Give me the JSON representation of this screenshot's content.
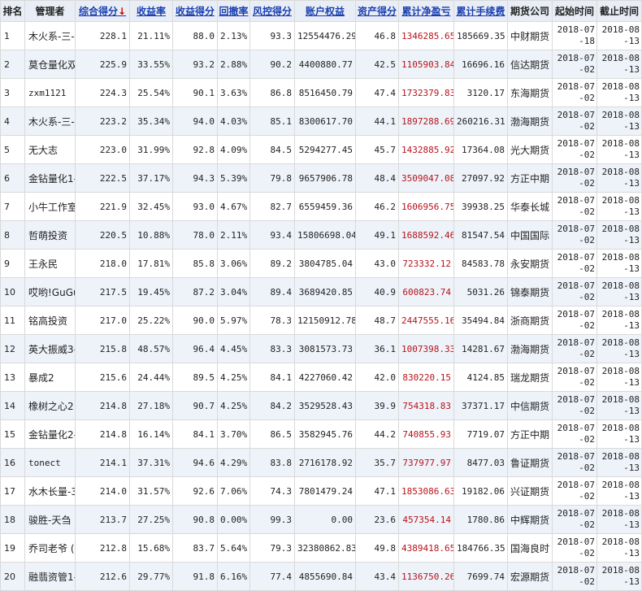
{
  "colors": {
    "header_bg": "#e9eef6",
    "link": "#1a3fb0",
    "profit": "#b8121a",
    "stripe": "#eef3fa",
    "sort_arrow": "#d00000"
  },
  "headers": {
    "rank": "排名",
    "manager": "管理者",
    "composite": "综合得分",
    "sort_arrow": "↓",
    "return_rate": "收益率",
    "return_score": "收益得分",
    "drawdown": "回撤率",
    "risk_score": "风控得分",
    "equity": "账户权益",
    "asset_score": "资产得分",
    "net_profit": "累计净盈亏",
    "fees": "累计手续费",
    "company": "期货公司",
    "start": "起始时间",
    "end": "截止时间"
  },
  "rows": [
    {
      "rank": "1",
      "manager": "木火系-三-",
      "composite": "228.1",
      "return_rate": "21.11%",
      "return_score": "88.0",
      "drawdown": "2.13%",
      "risk_score": "93.3",
      "equity": "12554476.29",
      "asset_score": "46.8",
      "net_profit": "1346285.65",
      "fees": "185669.35",
      "company": "中财期货",
      "start": "2018-07-18",
      "end": "2018-08-13"
    },
    {
      "rank": "2",
      "manager": "莫仓量化双",
      "composite": "225.9",
      "return_rate": "33.55%",
      "return_score": "93.2",
      "drawdown": "2.88%",
      "risk_score": "90.2",
      "equity": "4400880.77",
      "asset_score": "42.5",
      "net_profit": "1105903.84",
      "fees": "16696.16",
      "company": "信达期货",
      "start": "2018-07-02",
      "end": "2018-08-13"
    },
    {
      "rank": "3",
      "manager": "zxm1121",
      "composite": "224.3",
      "return_rate": "25.54%",
      "return_score": "90.1",
      "drawdown": "3.63%",
      "risk_score": "86.8",
      "equity": "8516450.79",
      "asset_score": "47.4",
      "net_profit": "1732379.83",
      "fees": "3120.17",
      "company": "东海期货",
      "start": "2018-07-02",
      "end": "2018-08-13"
    },
    {
      "rank": "4",
      "manager": "木火系-三-",
      "composite": "223.2",
      "return_rate": "35.34%",
      "return_score": "94.0",
      "drawdown": "4.03%",
      "risk_score": "85.1",
      "equity": "8300617.70",
      "asset_score": "44.1",
      "net_profit": "1897288.69",
      "fees": "260216.31",
      "company": "渤海期货",
      "start": "2018-07-02",
      "end": "2018-08-13"
    },
    {
      "rank": "5",
      "manager": "无大志",
      "composite": "223.0",
      "return_rate": "31.99%",
      "return_score": "92.8",
      "drawdown": "4.09%",
      "risk_score": "84.5",
      "equity": "5294277.45",
      "asset_score": "45.7",
      "net_profit": "1432885.92",
      "fees": "17364.08",
      "company": "光大期货",
      "start": "2018-07-02",
      "end": "2018-08-13"
    },
    {
      "rank": "6",
      "manager": "金钻量化1-",
      "composite": "222.5",
      "return_rate": "37.17%",
      "return_score": "94.3",
      "drawdown": "5.39%",
      "risk_score": "79.8",
      "equity": "9657906.78",
      "asset_score": "48.4",
      "net_profit": "3509047.08",
      "fees": "27097.92",
      "company": "方正中期",
      "start": "2018-07-02",
      "end": "2018-08-13"
    },
    {
      "rank": "7",
      "manager": "小牛工作室",
      "composite": "221.9",
      "return_rate": "32.45%",
      "return_score": "93.0",
      "drawdown": "4.67%",
      "risk_score": "82.7",
      "equity": "6559459.36",
      "asset_score": "46.2",
      "net_profit": "1606956.75",
      "fees": "39938.25",
      "company": "华泰长城",
      "start": "2018-07-02",
      "end": "2018-08-13"
    },
    {
      "rank": "8",
      "manager": "哲萌投资",
      "composite": "220.5",
      "return_rate": "10.88%",
      "return_score": "78.0",
      "drawdown": "2.11%",
      "risk_score": "93.4",
      "equity": "15806698.04",
      "asset_score": "49.1",
      "net_profit": "1688592.46",
      "fees": "81547.54",
      "company": "中国国际",
      "start": "2018-07-02",
      "end": "2018-08-13"
    },
    {
      "rank": "9",
      "manager": "王永民",
      "composite": "218.0",
      "return_rate": "17.81%",
      "return_score": "85.8",
      "drawdown": "3.06%",
      "risk_score": "89.2",
      "equity": "3804785.04",
      "asset_score": "43.0",
      "net_profit": "723332.12",
      "fees": "84583.78",
      "company": "永安期货",
      "start": "2018-07-02",
      "end": "2018-08-13"
    },
    {
      "rank": "10",
      "manager": "哎哟!GuGu",
      "composite": "217.5",
      "return_rate": "19.45%",
      "return_score": "87.2",
      "drawdown": "3.04%",
      "risk_score": "89.4",
      "equity": "3689420.85",
      "asset_score": "40.9",
      "net_profit": "600823.74",
      "fees": "5031.26",
      "company": "锦泰期货",
      "start": "2018-07-02",
      "end": "2018-08-13"
    },
    {
      "rank": "11",
      "manager": "铭高投资",
      "composite": "217.0",
      "return_rate": "25.22%",
      "return_score": "90.0",
      "drawdown": "5.97%",
      "risk_score": "78.3",
      "equity": "12150912.78",
      "asset_score": "48.7",
      "net_profit": "2447555.16",
      "fees": "35494.84",
      "company": "浙商期货",
      "start": "2018-07-02",
      "end": "2018-08-13"
    },
    {
      "rank": "12",
      "manager": "英大振威3-",
      "composite": "215.8",
      "return_rate": "48.57%",
      "return_score": "96.4",
      "drawdown": "4.45%",
      "risk_score": "83.3",
      "equity": "3081573.73",
      "asset_score": "36.1",
      "net_profit": "1007398.33",
      "fees": "14281.67",
      "company": "渤海期货",
      "start": "2018-07-02",
      "end": "2018-08-13"
    },
    {
      "rank": "13",
      "manager": "暴成2",
      "composite": "215.6",
      "return_rate": "24.44%",
      "return_score": "89.5",
      "drawdown": "4.25%",
      "risk_score": "84.1",
      "equity": "4227060.42",
      "asset_score": "42.0",
      "net_profit": "830220.15",
      "fees": "4124.85",
      "company": "瑞龙期货",
      "start": "2018-07-02",
      "end": "2018-08-13"
    },
    {
      "rank": "14",
      "manager": "橡树之心2",
      "composite": "214.8",
      "return_rate": "27.18%",
      "return_score": "90.7",
      "drawdown": "4.25%",
      "risk_score": "84.2",
      "equity": "3529528.43",
      "asset_score": "39.9",
      "net_profit": "754318.83",
      "fees": "37371.17",
      "company": "中信期货",
      "start": "2018-07-02",
      "end": "2018-08-13"
    },
    {
      "rank": "15",
      "manager": "金钻量化2-",
      "composite": "214.8",
      "return_rate": "16.14%",
      "return_score": "84.1",
      "drawdown": "3.70%",
      "risk_score": "86.5",
      "equity": "3582945.76",
      "asset_score": "44.2",
      "net_profit": "740855.93",
      "fees": "7719.07",
      "company": "方正中期",
      "start": "2018-07-02",
      "end": "2018-08-13"
    },
    {
      "rank": "16",
      "manager": "tonect",
      "composite": "214.1",
      "return_rate": "37.31%",
      "return_score": "94.6",
      "drawdown": "4.29%",
      "risk_score": "83.8",
      "equity": "2716178.92",
      "asset_score": "35.7",
      "net_profit": "737977.97",
      "fees": "8477.03",
      "company": "鲁证期货",
      "start": "2018-07-02",
      "end": "2018-08-13"
    },
    {
      "rank": "17",
      "manager": "水木长量-3",
      "composite": "214.0",
      "return_rate": "31.57%",
      "return_score": "92.6",
      "drawdown": "7.06%",
      "risk_score": "74.3",
      "equity": "7801479.24",
      "asset_score": "47.1",
      "net_profit": "1853086.63",
      "fees": "19182.06",
      "company": "兴证期货",
      "start": "2018-07-02",
      "end": "2018-08-13"
    },
    {
      "rank": "18",
      "manager": "骏胜-天刍",
      "composite": "213.7",
      "return_rate": "27.25%",
      "return_score": "90.8",
      "drawdown": "0.00%",
      "risk_score": "99.3",
      "equity": "0.00",
      "asset_score": "23.6",
      "net_profit": "457354.14",
      "fees": "1780.86",
      "company": "中辉期货",
      "start": "2018-07-02",
      "end": "2018-08-13"
    },
    {
      "rank": "19",
      "manager": "乔司老爷 (",
      "composite": "212.8",
      "return_rate": "15.68%",
      "return_score": "83.7",
      "drawdown": "5.64%",
      "risk_score": "79.3",
      "equity": "32380862.83",
      "asset_score": "49.8",
      "net_profit": "4389418.65",
      "fees": "184766.35",
      "company": "国海良时",
      "start": "2018-07-02",
      "end": "2018-08-13"
    },
    {
      "rank": "20",
      "manager": "融翡资管1-",
      "composite": "212.6",
      "return_rate": "29.77%",
      "return_score": "91.8",
      "drawdown": "6.16%",
      "risk_score": "77.4",
      "equity": "4855690.84",
      "asset_score": "43.4",
      "net_profit": "1136750.26",
      "fees": "7699.74",
      "company": "宏源期货",
      "start": "2018-07-02",
      "end": "2018-08-13"
    }
  ]
}
